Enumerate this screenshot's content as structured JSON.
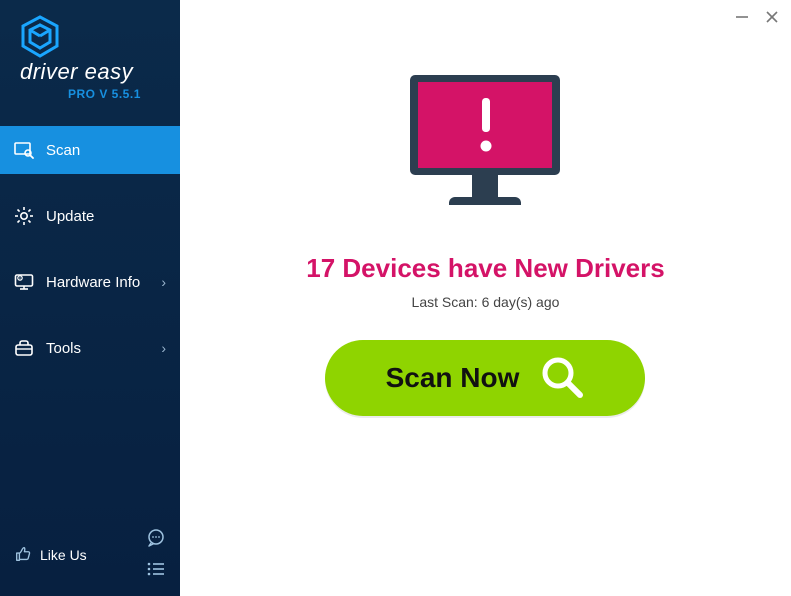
{
  "app": {
    "name": "driver easy",
    "version_label": "PRO V 5.5.1"
  },
  "sidebar": {
    "items": [
      {
        "label": "Scan"
      },
      {
        "label": "Update"
      },
      {
        "label": "Hardware Info"
      },
      {
        "label": "Tools"
      }
    ],
    "like_us_label": "Like Us"
  },
  "main": {
    "headline": "17 Devices have New Drivers",
    "last_scan": "Last Scan: 6 day(s) ago",
    "scan_button_label": "Scan Now"
  },
  "colors": {
    "accent": "#1790e0",
    "sidebar_bg": "#0b2a4a",
    "headline": "#d41367",
    "scan_btn": "#8fd400",
    "monitor_screen": "#d41367",
    "monitor_body": "#2c3e50"
  }
}
